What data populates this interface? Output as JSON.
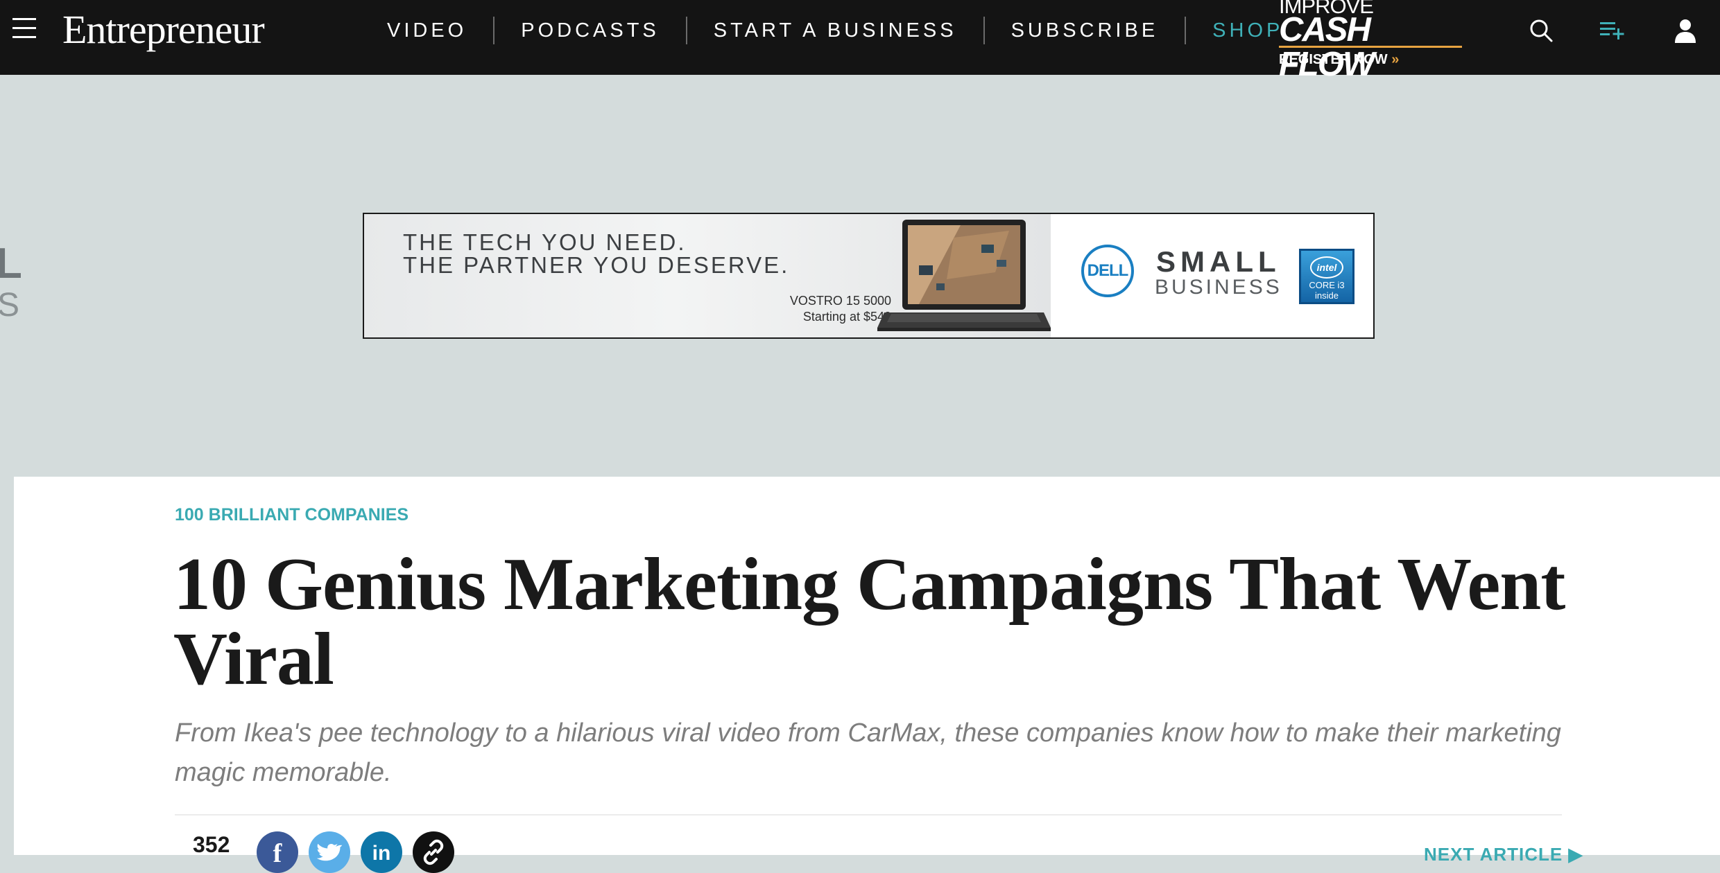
{
  "nav": {
    "logo": "Entrepreneur",
    "links": [
      {
        "label": "VIDEO"
      },
      {
        "label": "PODCASTS"
      },
      {
        "label": "START A BUSINESS"
      },
      {
        "label": "SUBSCRIBE"
      },
      {
        "label": "SHOP"
      }
    ],
    "promo": {
      "top": "IMPROVE",
      "main": "CASH FLOW",
      "cta": "REGISTER NOW",
      "cta_chevrons": "»"
    },
    "icons": [
      "menu-icon",
      "search-icon",
      "playlist-add-icon",
      "user-icon"
    ],
    "accent_color": "#3fb1b8"
  },
  "ad": {
    "left_edge_text": {
      "big": "L",
      "small": "S"
    },
    "headline_line1": "THE TECH YOU NEED.",
    "headline_line2": "THE PARTNER YOU DESERVE.",
    "product_name": "VOSTRO 15 5000",
    "product_price": "Starting at $549",
    "brand": "DELL",
    "tagline_line1": "SMALL",
    "tagline_line2": "BUSINESS",
    "badge_brand": "intel",
    "badge_line1": "CORE i3",
    "badge_line2": "inside"
  },
  "article": {
    "category": "100 BRILLIANT COMPANIES",
    "headline": "10 Genius Marketing Campaigns That Went Viral",
    "dek": "From Ikea's pee technology to a hilarious viral video from CarMax, these companies know how to make their marketing magic memorable.",
    "share_count": "352",
    "social": {
      "facebook": "f",
      "linkedin": "in"
    },
    "next_label": "NEXT ARTICLE",
    "next_arrow": "▶"
  }
}
